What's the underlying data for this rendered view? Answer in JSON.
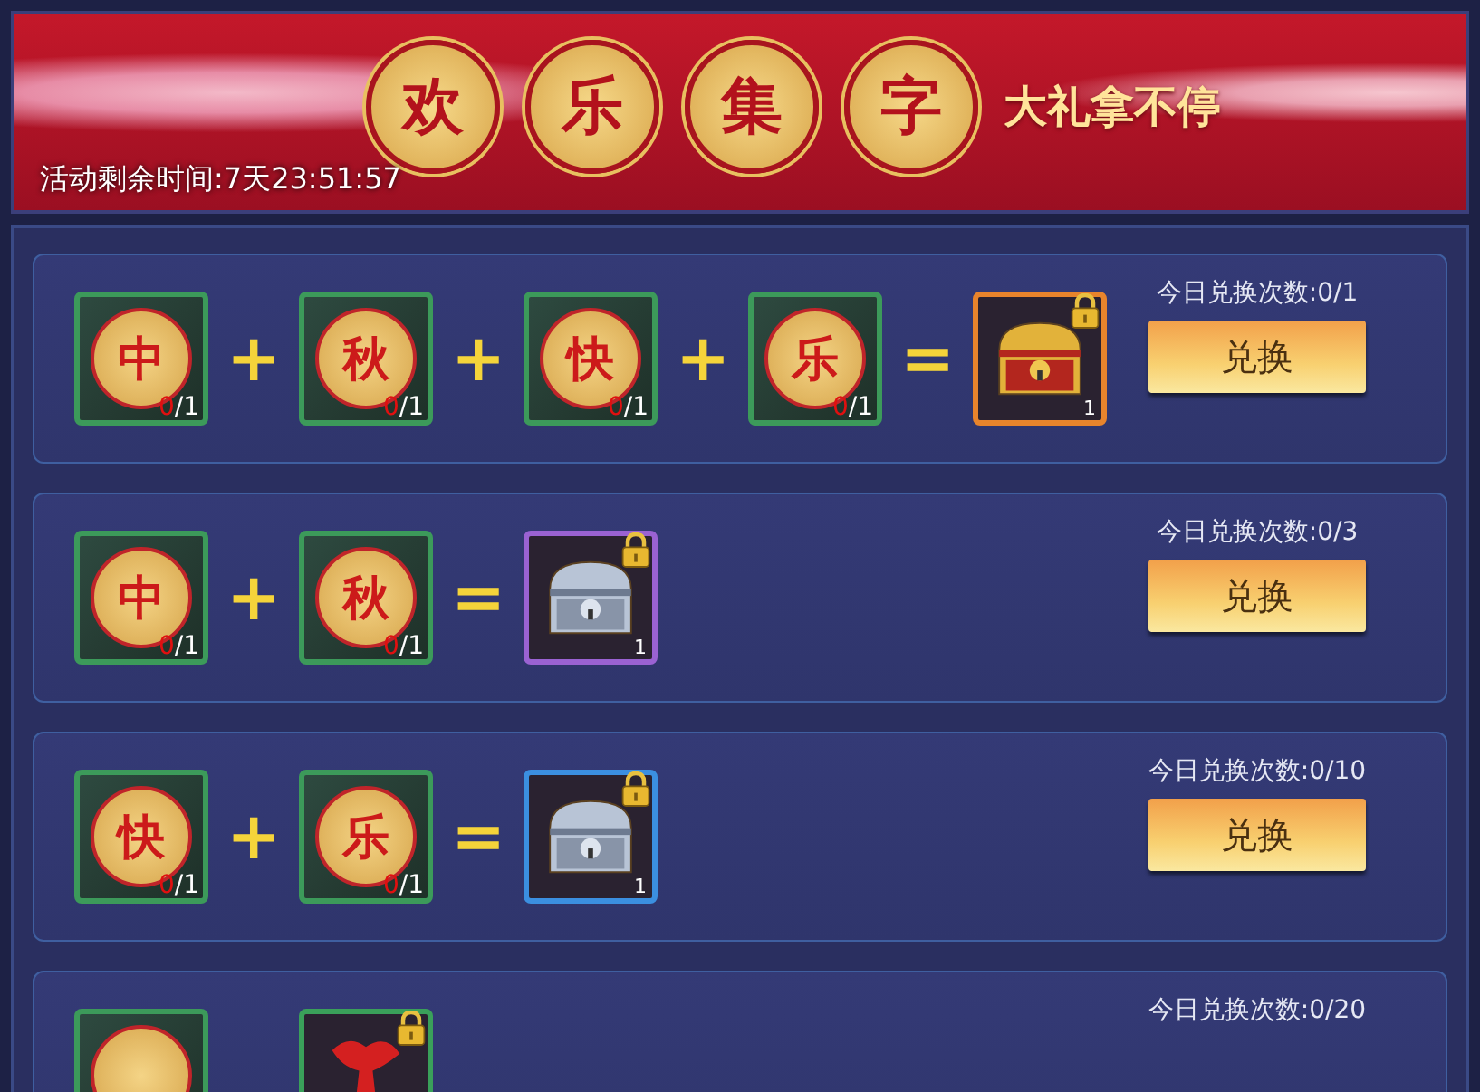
{
  "banner": {
    "title_chars": [
      "欢",
      "乐",
      "集",
      "字"
    ],
    "slogan": "大礼拿不停",
    "timer": "活动剩余时间:7天23:51:57"
  },
  "recipes": [
    {
      "items": [
        {
          "kind": "coin",
          "char": "中",
          "have": "0",
          "need": "/1"
        },
        {
          "kind": "coin",
          "char": "秋",
          "have": "0",
          "need": "/1"
        },
        {
          "kind": "coin",
          "char": "快",
          "have": "0",
          "need": "/1"
        },
        {
          "kind": "coin",
          "char": "乐",
          "have": "0",
          "need": "/1"
        }
      ],
      "plus": [
        "+",
        "+",
        "+"
      ],
      "equals": "=",
      "reward": {
        "kind": "gold-chest",
        "color": "#e8842c",
        "locked": true,
        "count": "1"
      },
      "limit": "今日兑换次数:0/1",
      "button": "兑换"
    },
    {
      "items": [
        {
          "kind": "coin",
          "char": "中",
          "have": "0",
          "need": "/1"
        },
        {
          "kind": "coin",
          "char": "秋",
          "have": "0",
          "need": "/1"
        }
      ],
      "plus": [
        "+"
      ],
      "equals": "=",
      "reward": {
        "kind": "silver-chest",
        "color": "#9a62d2",
        "locked": true,
        "count": "1"
      },
      "limit": "今日兑换次数:0/3",
      "button": "兑换"
    },
    {
      "items": [
        {
          "kind": "coin",
          "char": "快",
          "have": "0",
          "need": "/1"
        },
        {
          "kind": "coin",
          "char": "乐",
          "have": "0",
          "need": "/1"
        }
      ],
      "plus": [
        "+"
      ],
      "equals": "=",
      "reward": {
        "kind": "silver-chest",
        "color": "#3b8fe0",
        "locked": true,
        "count": "1"
      },
      "limit": "今日兑换次数:0/10",
      "button": "兑换"
    },
    {
      "items": [
        {
          "kind": "coin"
        }
      ],
      "reward": {
        "kind": "pouch",
        "color": "#3aa05a",
        "locked": true
      },
      "limit": "今日兑换次数:0/20"
    }
  ]
}
